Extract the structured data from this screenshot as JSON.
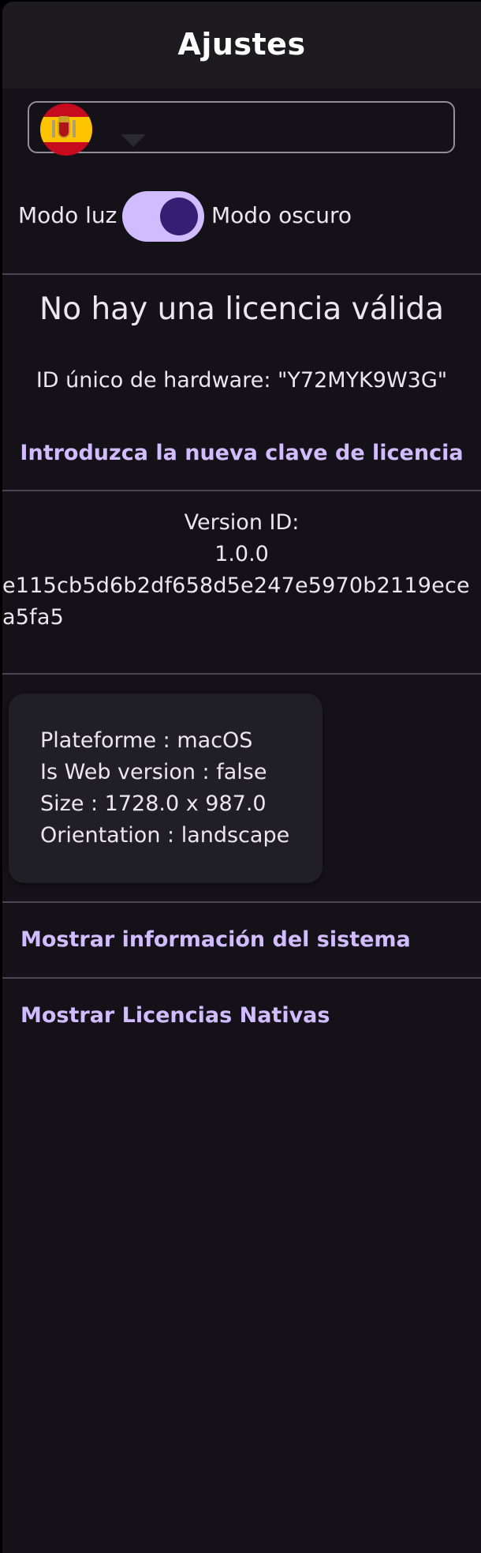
{
  "appbar": {
    "title": "Ajustes"
  },
  "language": {
    "selected_flag": "spain-flag-icon",
    "arrow": "dropdown-arrow-icon"
  },
  "theme": {
    "light_label": "Modo luz",
    "dark_label": "Modo oscuro",
    "dark_mode_enabled": true
  },
  "license": {
    "status": "No hay una licencia válida",
    "hardware_id": "ID único de hardware: \"Y72MYK9W3G\"",
    "enter_key_link": "Introduzca la nueva clave de licencia"
  },
  "version": {
    "label": "Version ID:",
    "number": "1.0.0",
    "hash": "e115cb5d6b2df658d5e247e5970b2119ecea5fa5"
  },
  "system_info": {
    "platform": "Plateforme : macOS",
    "web_version": "Is Web version : false",
    "size": "Size : 1728.0 x 987.0",
    "orientation": "Orientation : landscape"
  },
  "actions": {
    "show_system_info": "Mostrar información del sistema",
    "show_native_licenses": "Mostrar Licencias Nativas"
  },
  "colors": {
    "background": "#141218",
    "appbar": "#1D1B20",
    "accent": "#D0BCFF",
    "toggle_thumb": "#381E72",
    "text": "#ECE6F0"
  }
}
